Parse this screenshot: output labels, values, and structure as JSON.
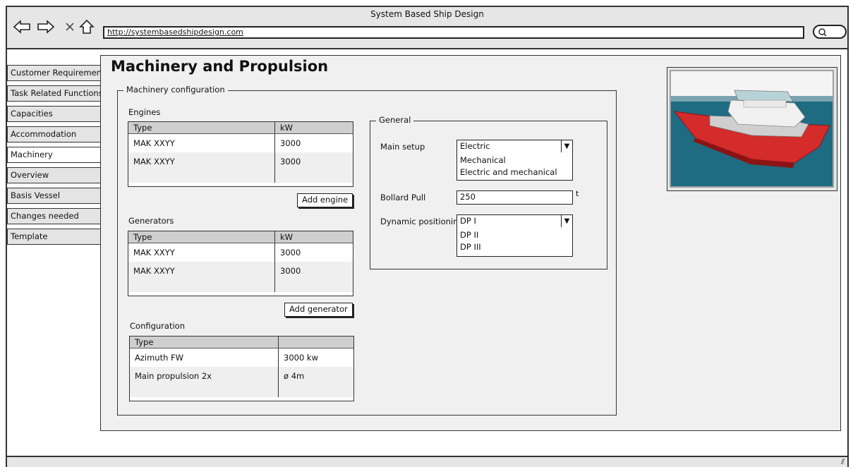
{
  "window": {
    "title": "System Based Ship Design",
    "url": "http://systembasedshipdesign.com"
  },
  "nav_icons": [
    "back-arrow-icon",
    "forward-arrow-icon",
    "close-icon",
    "home-icon",
    "search-icon"
  ],
  "sidebar": {
    "items": [
      {
        "label": "Customer Requirements",
        "active": false
      },
      {
        "label": "Task Related Functions",
        "active": false
      },
      {
        "label": "Capacities",
        "active": false
      },
      {
        "label": "Accommodation",
        "active": false
      },
      {
        "label": "Machinery",
        "active": true
      },
      {
        "label": "Overview",
        "active": false
      },
      {
        "label": "Basis Vessel",
        "active": false
      },
      {
        "label": "Changes needed",
        "active": false
      },
      {
        "label": "Template",
        "active": false
      }
    ]
  },
  "main": {
    "title": "Machinery and Propulsion",
    "machinery_config_legend": "Machinery configuration",
    "engines": {
      "label": "Engines",
      "headers": [
        "Type",
        "kW"
      ],
      "rows": [
        [
          "MAK XXYY",
          "3000"
        ],
        [
          "MAK XXYY",
          "3000"
        ]
      ],
      "add_button": "Add engine"
    },
    "generators": {
      "label": "Generators",
      "headers": [
        "Type",
        "kW"
      ],
      "rows": [
        [
          "MAK XXYY",
          "3000"
        ],
        [
          "MAK XXYY",
          "3000"
        ]
      ],
      "add_button": "Add generator"
    },
    "configuration": {
      "label": "Configuration",
      "headers": [
        "Type",
        ""
      ],
      "rows": [
        [
          "Azimuth FW",
          "3000 kw"
        ],
        [
          "Main propulsion 2x",
          "ø 4m"
        ]
      ]
    },
    "general": {
      "legend": "General",
      "main_setup": {
        "label": "Main setup",
        "selected": "Electric",
        "options": [
          "Mechanical",
          "Electric and mechanical"
        ]
      },
      "bollard_pull": {
        "label": "Bollard Pull",
        "value": "250",
        "unit": "t"
      },
      "dynamic_positioning": {
        "label": "Dynamic positioning",
        "selected": "DP I",
        "options": [
          "DP II",
          "DP III"
        ]
      }
    }
  },
  "colors": {
    "chrome": "#e6e6e6",
    "panel": "#f0f0f0",
    "table_header": "#cfcfcf",
    "hull_red": "#d42b2b",
    "sea": "#1f6b82"
  }
}
